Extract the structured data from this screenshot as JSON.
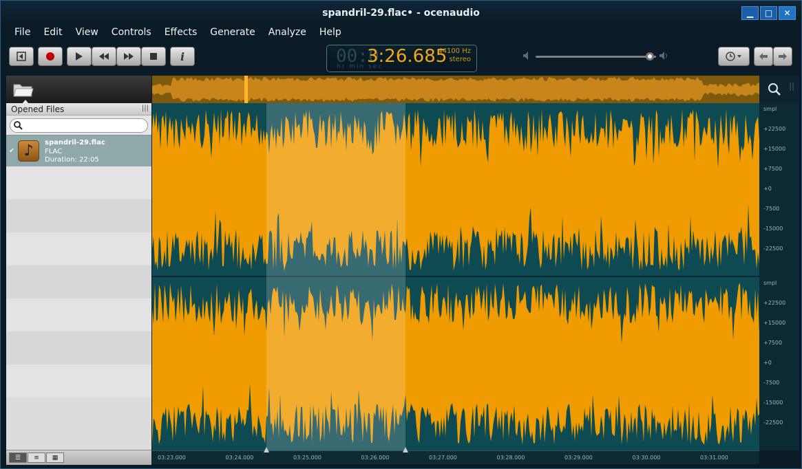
{
  "window": {
    "title": "spandril-29.flac• - ocenaudio",
    "buttons": {
      "minimize": "▁",
      "maximize": "□",
      "close": "✕"
    }
  },
  "menu": [
    "File",
    "Edit",
    "View",
    "Controls",
    "Effects",
    "Generate",
    "Analyze",
    "Help"
  ],
  "transport": {
    "display_dim": "00:0",
    "display_time": "3:26.685",
    "sample_rate": "44100 Hz",
    "channels": "stereo",
    "units": "hr  min  sec"
  },
  "volume": {
    "level": 0.97
  },
  "sidebar": {
    "header": "Opened Files",
    "search_placeholder": "",
    "files": [
      {
        "name": "spandril-29.flac",
        "format": "FLAC",
        "duration": "Duration: 22:05"
      }
    ]
  },
  "scale": {
    "top": [
      "smpl",
      "+22500",
      "+15000",
      "+7500",
      "+0",
      "-7500",
      "-15000",
      "-22500"
    ],
    "bottom": [
      "smpl",
      "+22500",
      "+15000",
      "+7500",
      "+0",
      "-7500",
      "-15000",
      "-22500"
    ]
  },
  "timeline": [
    "03:23.000",
    "03:24.000",
    "03:25.000",
    "03:26.000",
    "03:27.000",
    "03:28.000",
    "03:29.000",
    "03:30.000",
    "03:31.000"
  ],
  "colors": {
    "waveform": "#f09c00",
    "wave_bg": "#0d4a52",
    "selection": "#f4b24a"
  }
}
